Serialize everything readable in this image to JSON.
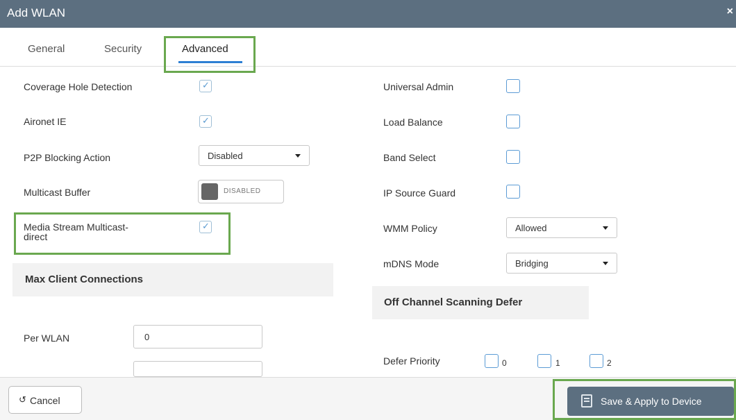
{
  "window": {
    "title": "Add WLAN",
    "close": "×"
  },
  "tabs": [
    {
      "label": "General"
    },
    {
      "label": "Security"
    },
    {
      "label": "Advanced"
    }
  ],
  "left": {
    "coverage_hole": {
      "label": "Coverage Hole Detection",
      "checked": true
    },
    "aironet_ie": {
      "label": "Aironet IE",
      "checked": true
    },
    "p2p": {
      "label": "P2P Blocking Action",
      "value": "Disabled"
    },
    "multicast_buffer": {
      "label": "Multicast Buffer",
      "state": "DISABLED"
    },
    "media_stream": {
      "label_line1": "Media Stream Multicast-",
      "label_line2": "direct",
      "checked": true
    },
    "max_client_header": "Max Client Connections",
    "per_wlan": {
      "label": "Per WLAN",
      "value": "0"
    }
  },
  "right": {
    "universal_admin": {
      "label": "Universal Admin",
      "checked": false
    },
    "load_balance": {
      "label": "Load Balance",
      "checked": false
    },
    "band_select": {
      "label": "Band Select",
      "checked": false
    },
    "ip_source_guard": {
      "label": "IP Source Guard",
      "checked": false
    },
    "wmm_policy": {
      "label": "WMM Policy",
      "value": "Allowed"
    },
    "mdns_mode": {
      "label": "mDNS Mode",
      "value": "Bridging"
    },
    "off_channel_header": "Off Channel Scanning Defer",
    "defer_priority": {
      "label": "Defer Priority",
      "options": [
        "0",
        "1",
        "2"
      ]
    }
  },
  "footer": {
    "cancel_label": "Cancel",
    "save_label": "Save & Apply to Device"
  },
  "colors": {
    "titlebar": "#5c6f80",
    "highlight": "#6aa84f",
    "tab_underline": "#2d7fd3"
  }
}
